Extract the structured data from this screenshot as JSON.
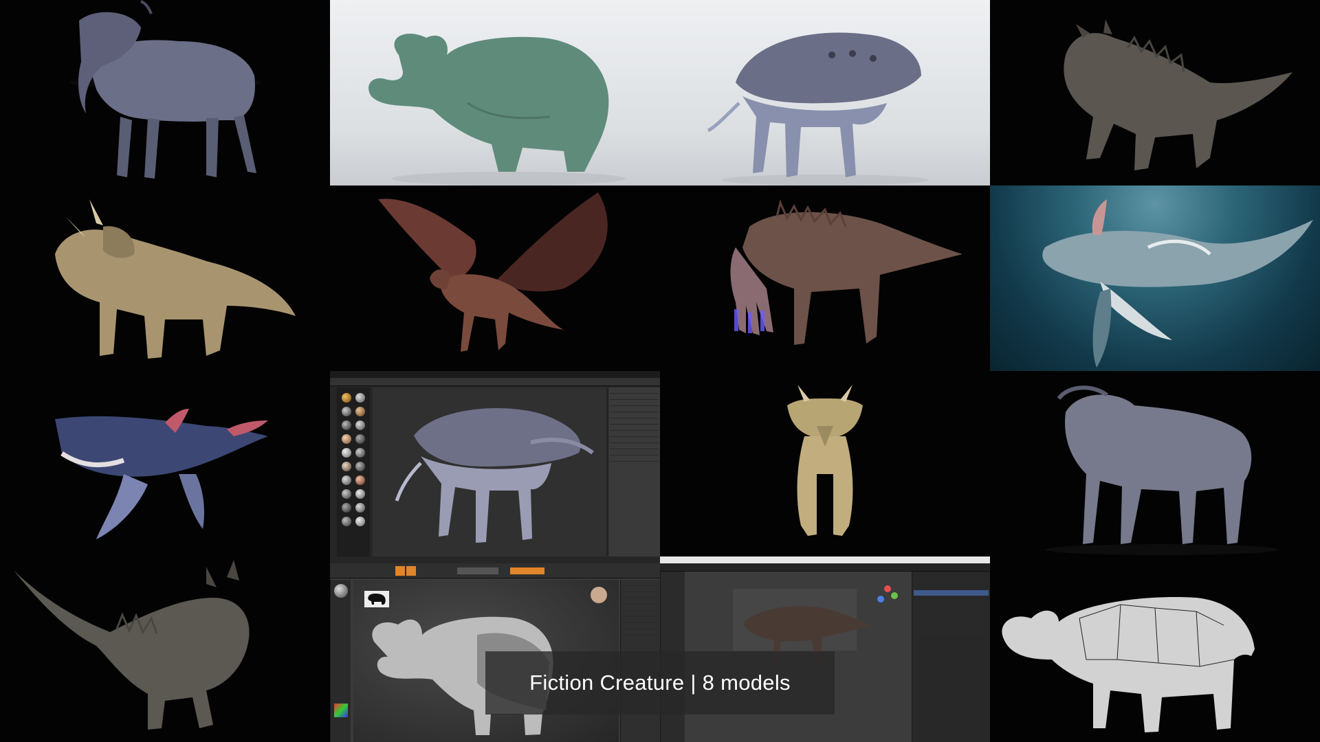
{
  "caption": {
    "text": "Fiction Creature | 8 models"
  },
  "tiles": [
    {
      "id": "horse-creature",
      "background": "dark"
    },
    {
      "id": "green-elephant",
      "background": "studio"
    },
    {
      "id": "spiked-quadruped-studio",
      "background": "studio"
    },
    {
      "id": "kaiju-lizard",
      "background": "dark"
    },
    {
      "id": "triceratops-side",
      "background": "dark"
    },
    {
      "id": "red-dragon",
      "background": "dark"
    },
    {
      "id": "armored-tentacle-beast",
      "background": "dark"
    },
    {
      "id": "underwater-horned-whale",
      "background": "water"
    },
    {
      "id": "sculpt-app-spiked-quadruped",
      "background": "app"
    },
    {
      "id": "triceratops-front",
      "background": "dark"
    },
    {
      "id": "horse-creature-2",
      "background": "dark"
    },
    {
      "id": "flying-horned-whale",
      "background": "dark"
    },
    {
      "id": "kaiju-lizard-back",
      "background": "dark"
    },
    {
      "id": "zbrush-elephant",
      "background": "app"
    },
    {
      "id": "blender-armored-beast",
      "background": "app"
    },
    {
      "id": "grey-elephant-wireframe",
      "background": "dark"
    }
  ],
  "colors": {
    "accent_orange": "#e0852a",
    "caption_bg": "#282828",
    "caption_text": "#ffffff"
  }
}
